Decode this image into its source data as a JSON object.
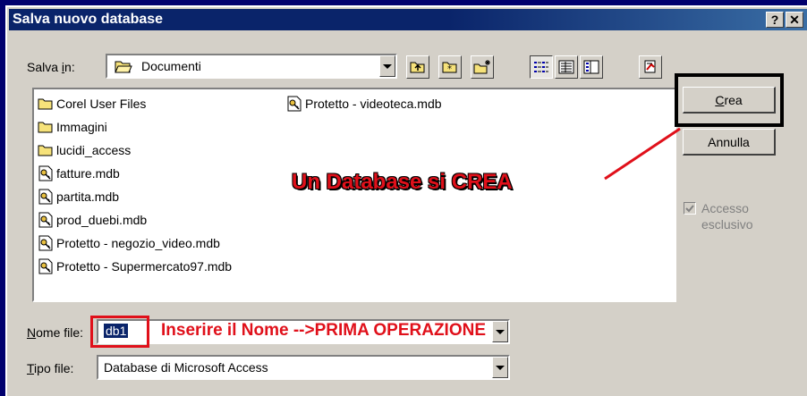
{
  "window": {
    "title": "Salva nuovo database",
    "help_label": "?",
    "close_label": "✕"
  },
  "save_in": {
    "label_prefix": "Salva ",
    "label_accel": "i",
    "label_suffix": "n:",
    "value": "Documenti"
  },
  "toolbar": {
    "buttons": [
      "up-one-level",
      "desktop",
      "create-new-folder",
      "list-view",
      "details-view",
      "properties-view",
      "tools"
    ]
  },
  "files": [
    {
      "name": "Corel User Files",
      "type": "folder"
    },
    {
      "name": "Immagini",
      "type": "folder"
    },
    {
      "name": "lucidi_access",
      "type": "folder"
    },
    {
      "name": "fatture.mdb",
      "type": "mdb"
    },
    {
      "name": "partita.mdb",
      "type": "mdb"
    },
    {
      "name": "prod_duebi.mdb",
      "type": "mdb"
    },
    {
      "name": "Protetto - negozio_video.mdb",
      "type": "mdb"
    },
    {
      "name": "Protetto - Supermercato97.mdb",
      "type": "mdb"
    },
    {
      "name": "Protetto - videoteca.mdb",
      "type": "mdb"
    }
  ],
  "buttons": {
    "crea_accel": "C",
    "crea_rest": "rea",
    "annulla": "Annulla"
  },
  "checkbox": {
    "label_line1": "Accesso",
    "label_line2": "esclusivo",
    "checked": true,
    "enabled": false
  },
  "file_name": {
    "label_accel": "N",
    "label_rest": "ome file:",
    "value": "db1"
  },
  "file_type": {
    "label_accel": "T",
    "label_rest": "ipo file:",
    "value": "Database di Microsoft Access"
  },
  "annotations": {
    "crea_note": "Un Database si CREA",
    "nome_note": "Inserire il Nome -->PRIMA OPERAZIONE"
  },
  "colors": {
    "annotation_red": "#e0101a",
    "titlebar": "#0a246a",
    "dialog_bg": "#d4d0c8"
  }
}
